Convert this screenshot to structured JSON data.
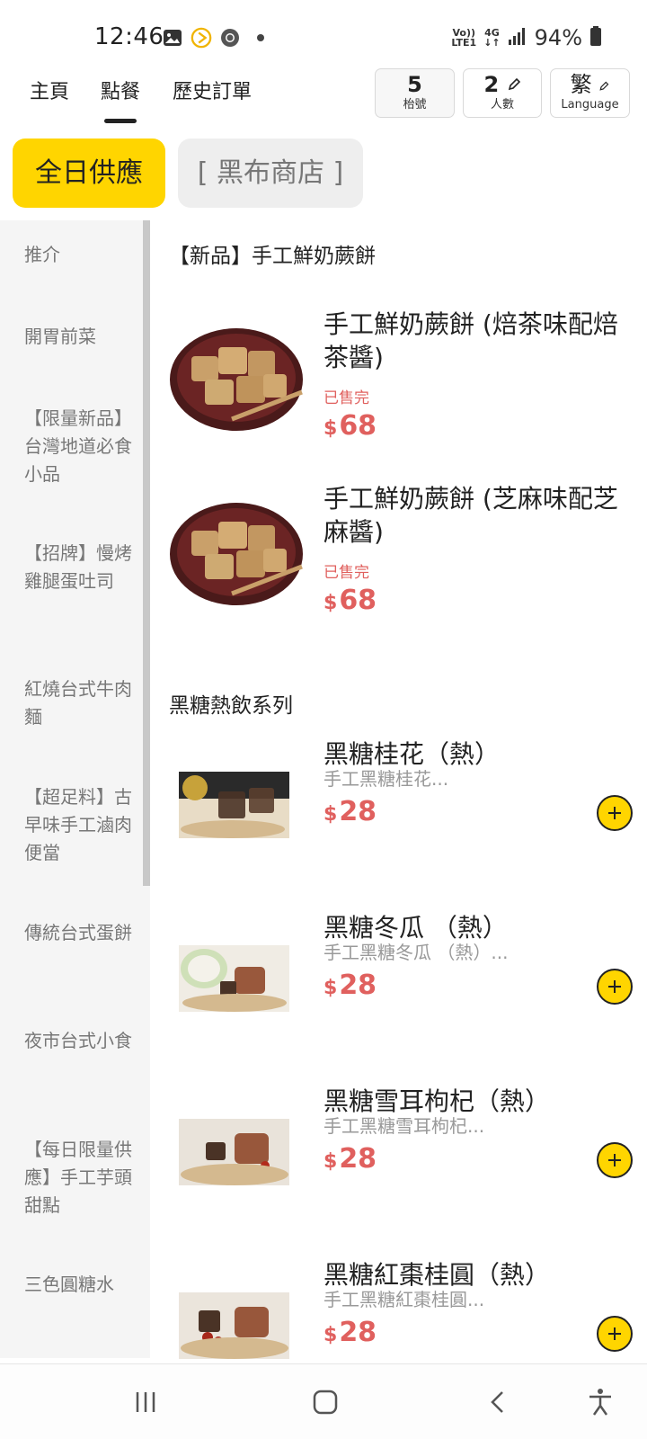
{
  "status_bar": {
    "time": "12:46",
    "network_top": "Vo))",
    "network_bottom": "LTE1",
    "network_type": "4G",
    "battery_percent": "94%",
    "icons": [
      "gallery-icon",
      "play-circle-icon",
      "chrome-icon",
      "dot-icon",
      "signal-icon",
      "battery-icon"
    ]
  },
  "nav": {
    "tabs": [
      {
        "label": "主頁"
      },
      {
        "label": "點餐"
      },
      {
        "label": "歷史訂單"
      }
    ],
    "active_tab": "點餐",
    "table": {
      "value": "5",
      "label": "枱號"
    },
    "people": {
      "value": "2",
      "label": "人數"
    },
    "language": {
      "value": "繁",
      "label": "Language"
    }
  },
  "menus": {
    "all_day": "全日供應",
    "store": "[ 黑布商店 ]"
  },
  "sidebar": {
    "items": [
      {
        "label": "推介"
      },
      {
        "label": "開胃前菜"
      },
      {
        "label": "【限量新品】台灣地道必食小品"
      },
      {
        "label": "【招牌】慢烤雞腿蛋吐司"
      },
      {
        "label": "紅燒台式牛肉麵"
      },
      {
        "label": "【超足料】古早味手工滷肉便當"
      },
      {
        "label": "傳統台式蛋餅"
      },
      {
        "label": "夜市台式小食"
      },
      {
        "label": "【每日限量供應】手工芋頭甜點"
      },
      {
        "label": "三色圓糖水"
      }
    ]
  },
  "sections": [
    {
      "title": "【新品】手工鮮奶蕨餅",
      "items": [
        {
          "name": "手工鮮奶蕨餅 (焙茶味配焙茶醬)",
          "status": "已售完",
          "currency": "$",
          "price": "68"
        },
        {
          "name": "手工鮮奶蕨餅 (芝麻味配芝麻醬)",
          "status": "已售完",
          "currency": "$",
          "price": "68"
        }
      ]
    },
    {
      "title": "黑糖熱飲系列",
      "items": [
        {
          "name": "黑糖桂花（熱）",
          "desc": "手工黑糖桂花...",
          "currency": "$",
          "price": "28"
        },
        {
          "name": "黑糖冬瓜 （熱）",
          "desc": "手工黑糖冬瓜 （熱）...",
          "currency": "$",
          "price": "28"
        },
        {
          "name": "黑糖雪耳枸杞（熱）",
          "desc": "手工黑糖雪耳枸杞...",
          "currency": "$",
          "price": "28"
        },
        {
          "name": "黑糖紅棗桂圓（熱）",
          "desc": "手工黑糖紅棗桂圓...",
          "currency": "$",
          "price": "28"
        }
      ]
    }
  ],
  "colors": {
    "accent": "#ffd500",
    "price": "#e0605e",
    "muted": "#999999"
  }
}
